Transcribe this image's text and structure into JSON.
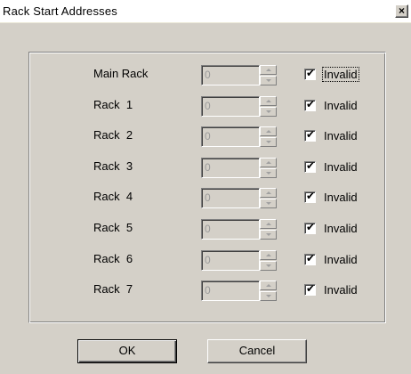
{
  "window": {
    "title": "Rack Start Addresses",
    "close_glyph": "×"
  },
  "racks": [
    {
      "label": "Main Rack",
      "value": "0",
      "checked": true,
      "check_label": "Invalid"
    },
    {
      "label": "Rack  1",
      "value": "0",
      "checked": true,
      "check_label": "Invalid"
    },
    {
      "label": "Rack  2",
      "value": "0",
      "checked": true,
      "check_label": "Invalid"
    },
    {
      "label": "Rack  3",
      "value": "0",
      "checked": true,
      "check_label": "Invalid"
    },
    {
      "label": "Rack  4",
      "value": "0",
      "checked": true,
      "check_label": "Invalid"
    },
    {
      "label": "Rack  5",
      "value": "0",
      "checked": true,
      "check_label": "Invalid"
    },
    {
      "label": "Rack  6",
      "value": "0",
      "checked": true,
      "check_label": "Invalid"
    },
    {
      "label": "Rack  7",
      "value": "0",
      "checked": true,
      "check_label": "Invalid"
    }
  ],
  "buttons": {
    "ok": "OK",
    "cancel": "Cancel"
  },
  "checkmark_glyph": "✔"
}
